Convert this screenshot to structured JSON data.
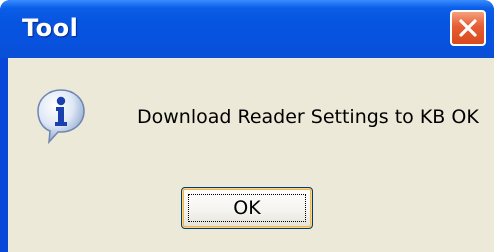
{
  "window": {
    "title": "Tool",
    "colors": {
      "titlebar": "#0654e0",
      "client": "#ece9d8",
      "close": "#e65d34"
    }
  },
  "dialog": {
    "icon": "info-icon",
    "message": "Download Reader Settings to KB OK",
    "ok_label": "OK"
  }
}
